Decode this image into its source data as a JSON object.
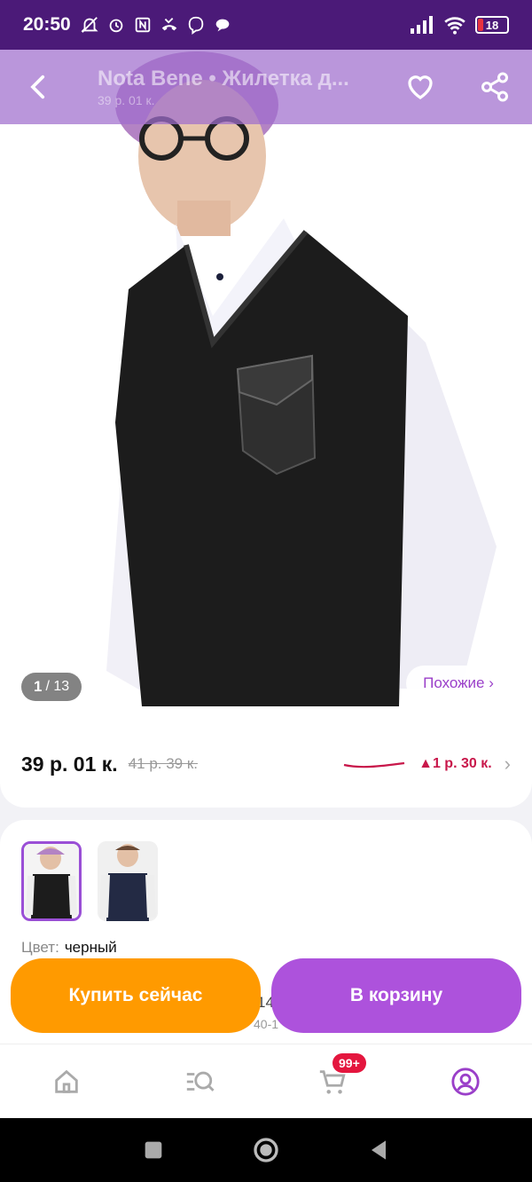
{
  "status_bar": {
    "time": "20:50",
    "battery": "18"
  },
  "header": {
    "title": "Nota Bene • Жилетка д...",
    "price": "39 р. 01 к."
  },
  "gallery": {
    "counter_current": "1",
    "counter_sep": " / 13",
    "similar_label": "Похожие ›"
  },
  "price": {
    "current": "39 р. 01 к.",
    "old": "41 р. 39 к.",
    "change": "▲1 р. 30 к."
  },
  "variant": {
    "color_label": "Цвет:",
    "color_value": "черный",
    "size_hint": "14",
    "size_hint2": "40-1"
  },
  "actions": {
    "buy_now": "Купить сейчас",
    "add_to_cart": "В корзину"
  },
  "nav": {
    "cart_badge": "99+"
  },
  "colors": {
    "brand_purple": "#ad52dc",
    "accent_orange": "#ff9a00",
    "status_purple": "#4b1a78"
  }
}
